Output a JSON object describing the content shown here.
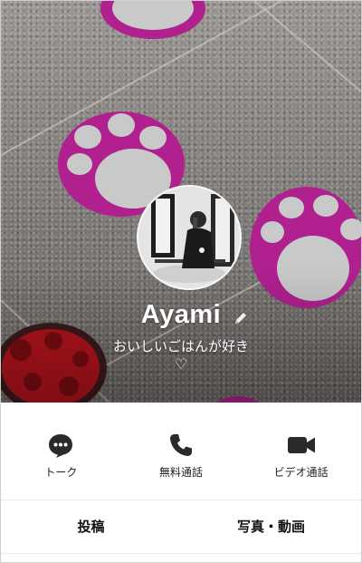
{
  "profile": {
    "name": "Ayami",
    "status_message": "おいしいごはんが好き",
    "status_extra": "♡"
  },
  "actions": [
    {
      "label": "トーク",
      "icon": "chat-bubble-icon"
    },
    {
      "label": "無料通話",
      "icon": "phone-icon"
    },
    {
      "label": "ビデオ通話",
      "icon": "video-camera-icon"
    }
  ],
  "tabs": [
    {
      "label": "投稿"
    },
    {
      "label": "写真・動画"
    }
  ],
  "colors": {
    "paw_magenta": "#b0208f",
    "paw_grey": "#c9c9c9",
    "red_circle": "#b3131c",
    "icon_dark": "#2a2a2a"
  }
}
